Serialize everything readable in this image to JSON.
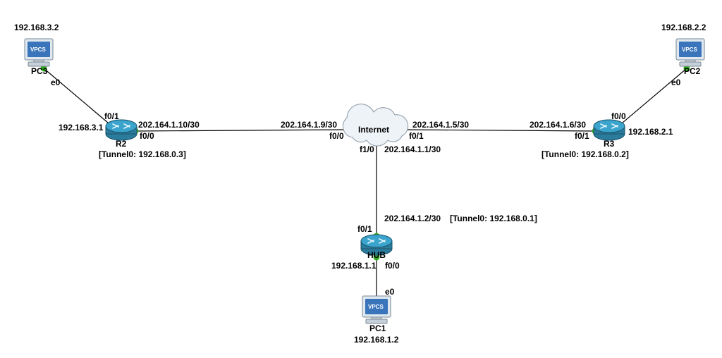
{
  "nodes": {
    "pc3": {
      "name": "PC3",
      "ip": "192.168.3.2",
      "iface0": "e0",
      "badge": "VPCS"
    },
    "pc2": {
      "name": "PC2",
      "ip": "192.168.2.2",
      "iface0": "e0",
      "badge": "VPCS"
    },
    "pc1": {
      "name": "PC1",
      "ip": "192.168.1.2",
      "iface0": "e0",
      "badge": "VPCS"
    },
    "r2": {
      "name": "R2",
      "if_lan": "f0/1",
      "if_wan": "f0/0",
      "ip_lan": "192.168.3.1",
      "ip_wan": "202.164.1.10/30",
      "tunnel": "[Tunnel0: 192.168.0.3]"
    },
    "r3": {
      "name": "R3",
      "if_lan": "f0/0",
      "if_wan": "f0/1",
      "ip_lan": "192.168.2.1",
      "ip_wan": "202.164.1.6/30",
      "tunnel": "[Tunnel0: 192.168.0.2]"
    },
    "hub": {
      "name": "HUB",
      "if_wan": "f0/1",
      "if_lan": "f0/0",
      "ip_wan": "202.164.1.2/30",
      "ip_lan": "192.168.1.1",
      "tunnel": "[Tunnel0: 192.168.0.1]"
    },
    "internet": {
      "name": "Internet",
      "if_left": "f0/0",
      "ip_left": "202.164.1.9/30",
      "if_right": "f0/1",
      "ip_right": "202.164.1.5/30",
      "if_down": "f1/0",
      "ip_down": "202.164.1.1/30"
    }
  },
  "colors": {
    "link_dot": "#2eae1c",
    "router_fill": "#3aa4cd",
    "cloud_fill": "#eef3f7"
  }
}
